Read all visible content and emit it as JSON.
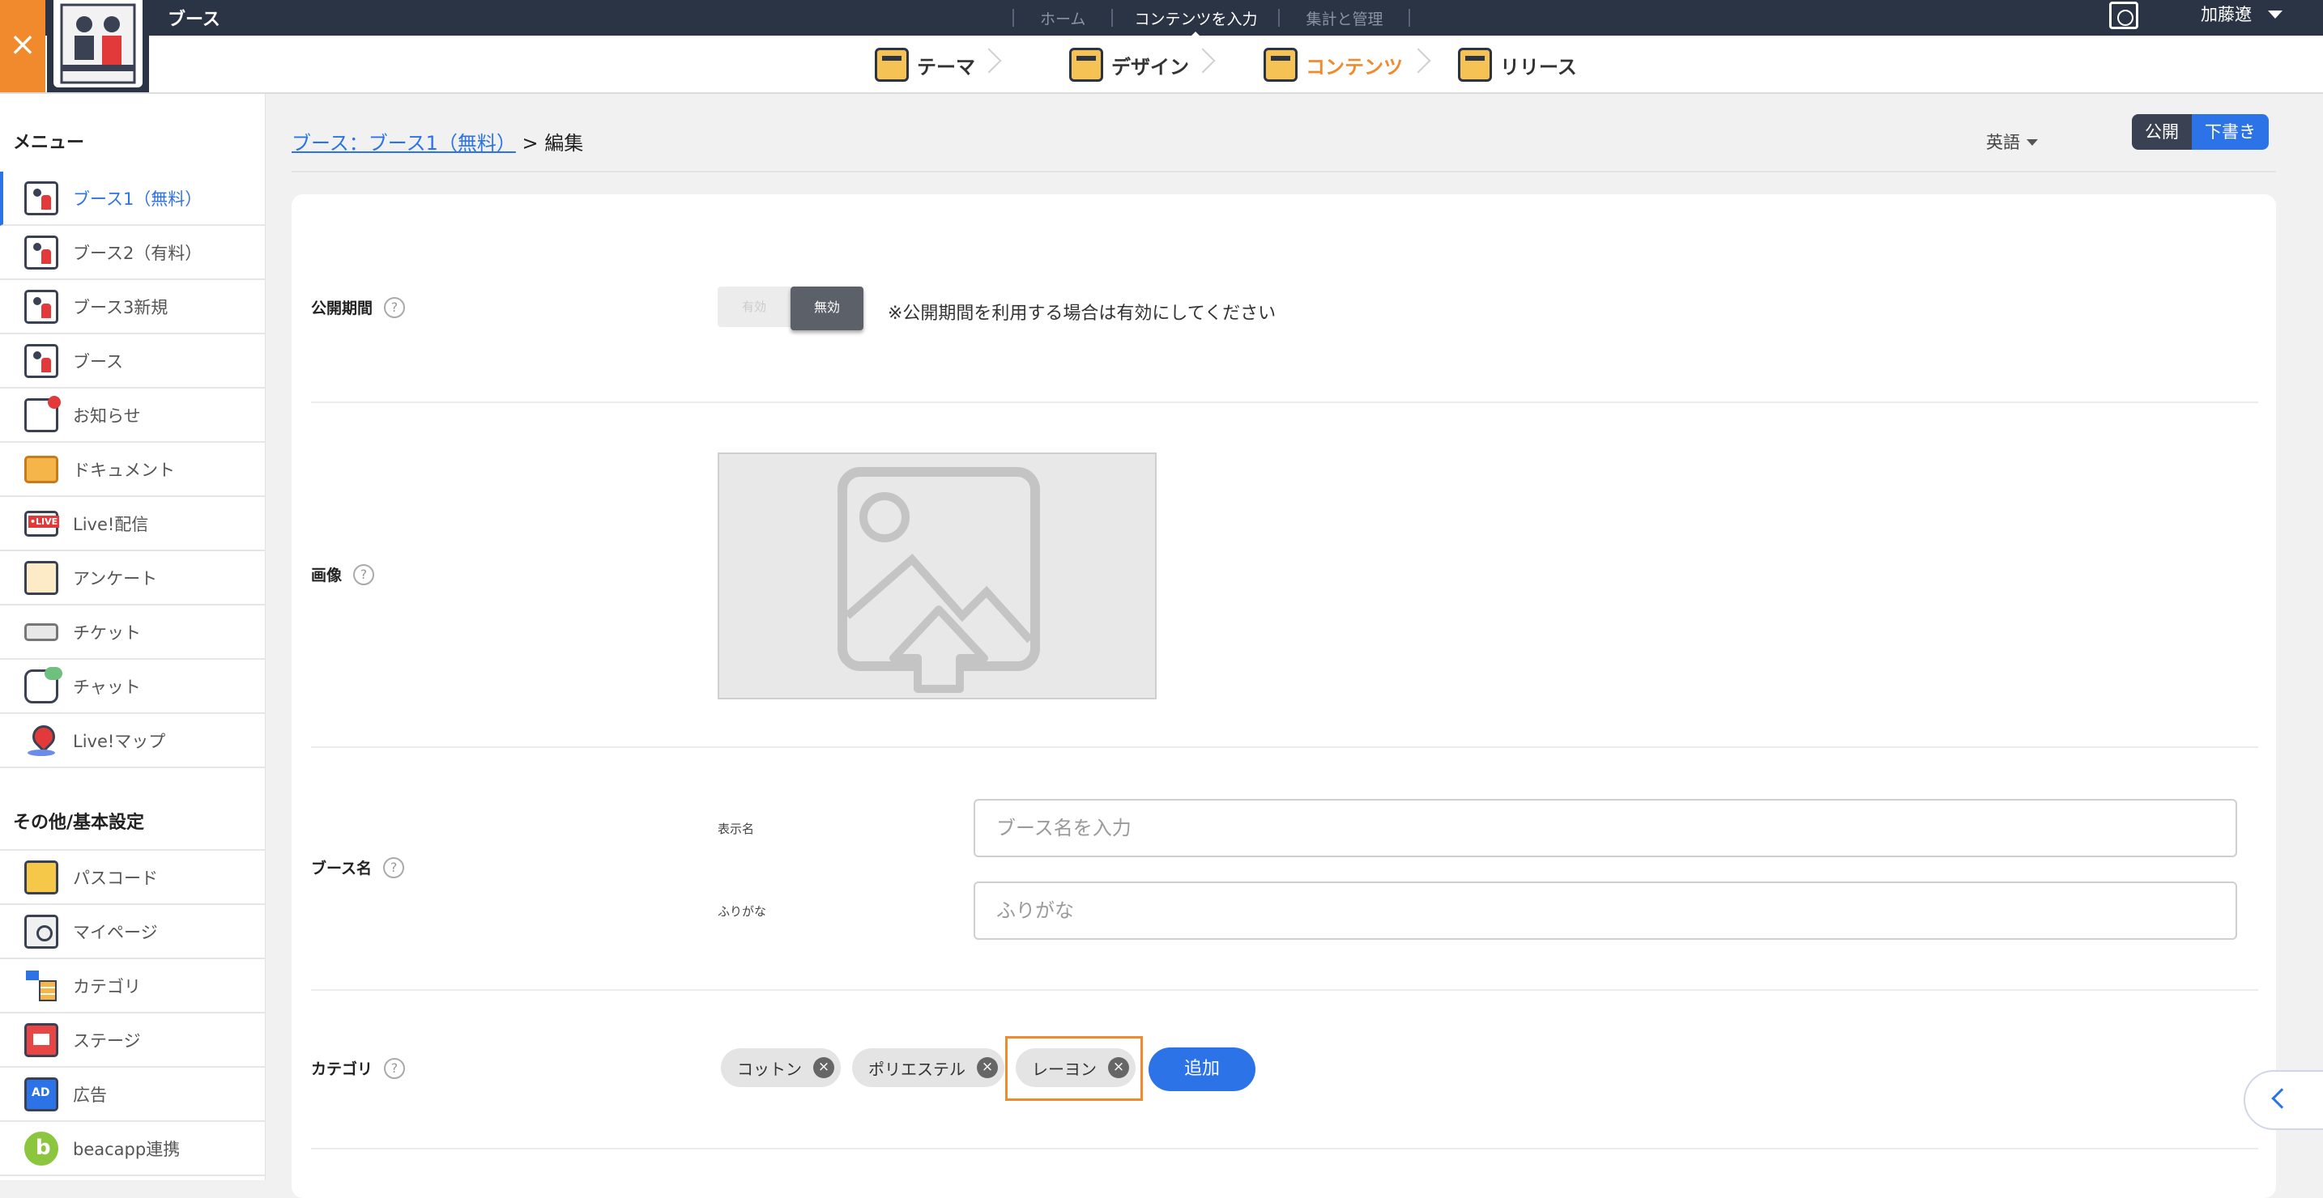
{
  "header": {
    "close_icon": "close-icon",
    "booth_title": "ブース",
    "nav": [
      {
        "label": "ホーム"
      },
      {
        "label": "コンテンツを入力"
      },
      {
        "label": "集計と管理"
      }
    ],
    "user_name": "加藤遼"
  },
  "steps": [
    {
      "label": "テーマ",
      "icon": "theme-icon"
    },
    {
      "label": "デザイン",
      "icon": "design-icon"
    },
    {
      "label": "コンテンツ",
      "icon": "contents-icon"
    },
    {
      "label": "リリース",
      "icon": "release-icon"
    }
  ],
  "sidebar": {
    "menu_heading": "メニュー",
    "items": [
      {
        "label": "ブース1（無料）"
      },
      {
        "label": "ブース2（有料）"
      },
      {
        "label": "ブース3新規"
      },
      {
        "label": "ブース"
      },
      {
        "label": "お知らせ"
      },
      {
        "label": "ドキュメント"
      },
      {
        "label": "Live!配信"
      },
      {
        "label": "アンケート"
      },
      {
        "label": "チケット"
      },
      {
        "label": "チャット"
      },
      {
        "label": "Live!マップ"
      }
    ],
    "other_heading": "その他/基本設定",
    "other_items": [
      {
        "label": "パスコード"
      },
      {
        "label": "マイページ"
      },
      {
        "label": "カテゴリ"
      },
      {
        "label": "ステージ"
      },
      {
        "label": "広告"
      },
      {
        "label": "beacapp連携"
      }
    ]
  },
  "main": {
    "breadcrumb_link": "ブース：ブース1（無料）",
    "breadcrumb_rest": "> 編集",
    "language": "英語",
    "publish_label": "公開",
    "draft_label": "下書き",
    "period": {
      "label": "公開期間",
      "on_label": "有効",
      "off_label": "無効",
      "note": "※公開期間を利用する場合は有効にしてください"
    },
    "image": {
      "label": "画像"
    },
    "booth_name": {
      "label": "ブース名",
      "display_label": "表示名",
      "display_placeholder": "ブース名を入力",
      "furigana_label": "ふりがな",
      "furigana_placeholder": "ふりがな"
    },
    "category": {
      "label": "カテゴリ",
      "tags": [
        "コットン",
        "ポリエステル",
        "レーヨン"
      ],
      "add_label": "追加"
    },
    "help_mark": "?"
  },
  "colors": {
    "accent_blue": "#2d73e8",
    "accent_orange": "#f08a2c",
    "header_dark": "#2b3445"
  }
}
